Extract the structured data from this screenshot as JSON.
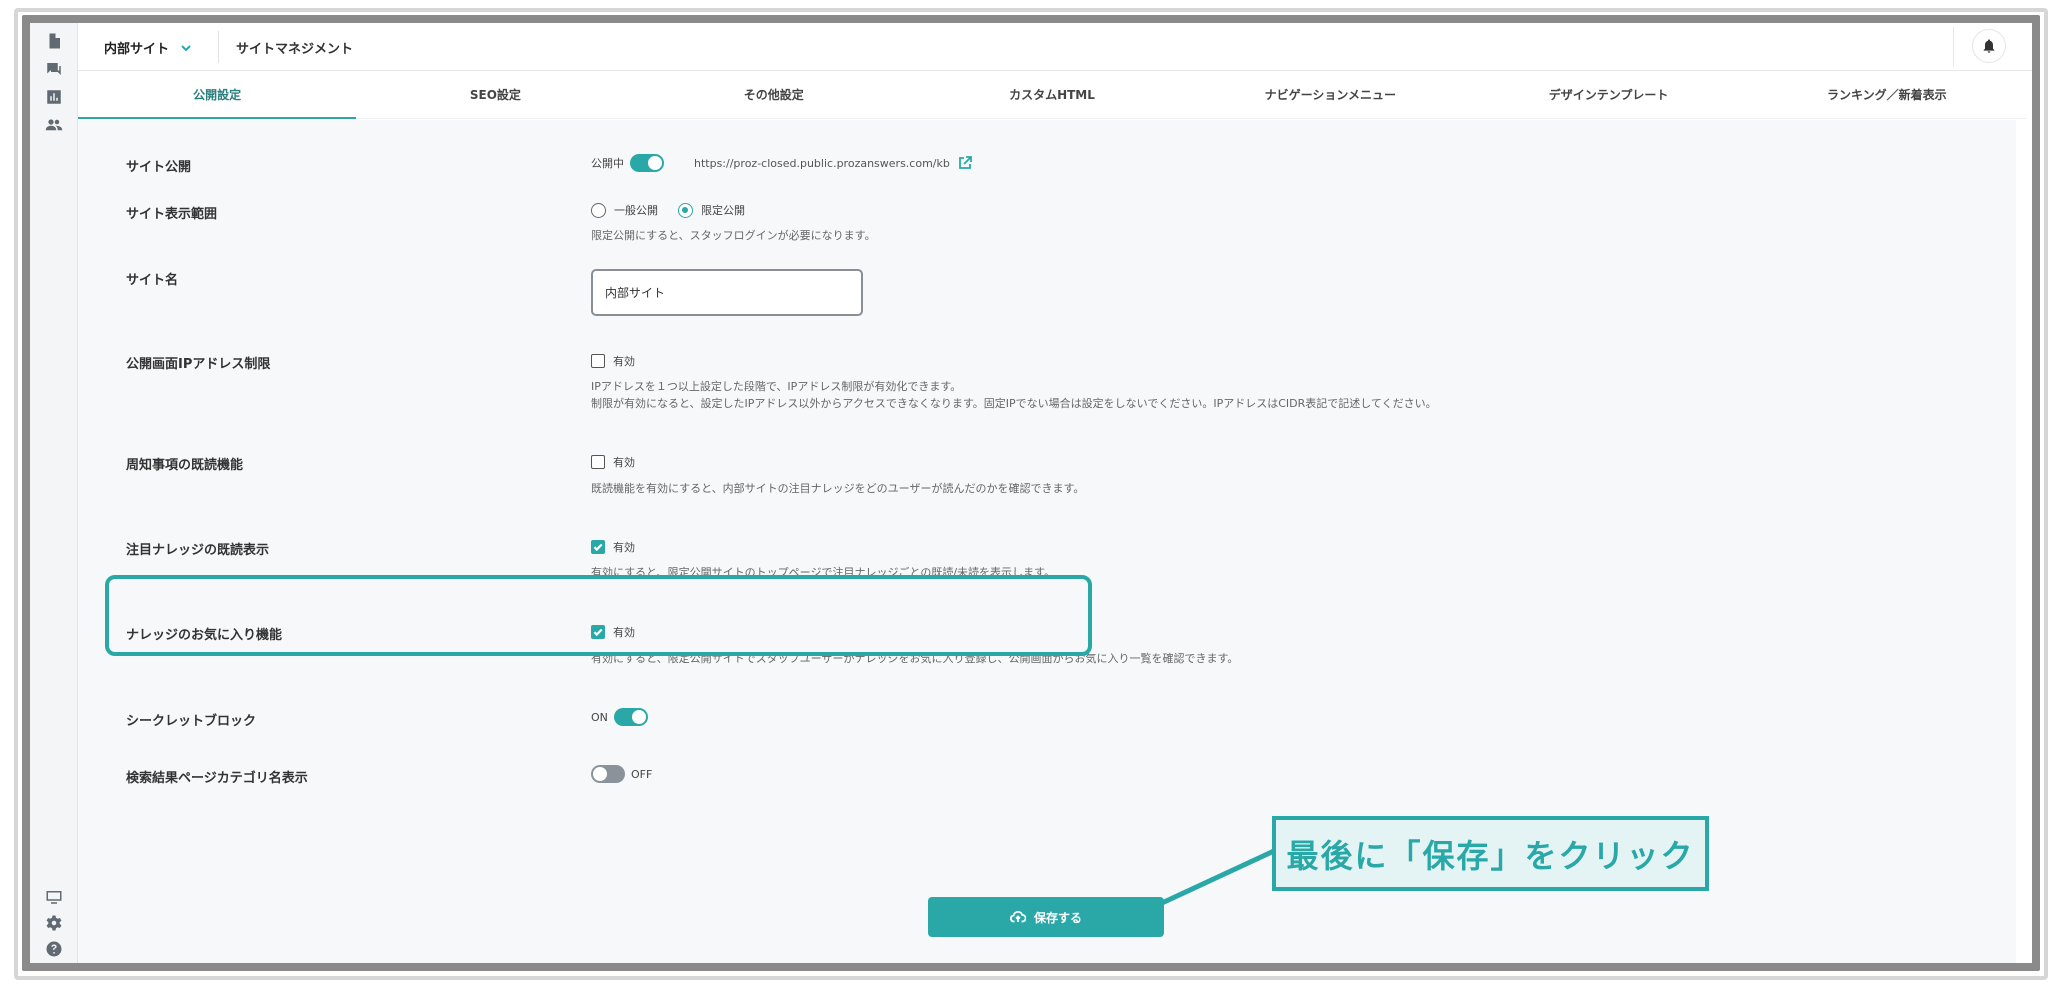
{
  "header": {
    "site_name": "内部サイト",
    "title": "サイトマネジメント"
  },
  "tabs": [
    {
      "label": "公開設定",
      "active": true
    },
    {
      "label": "SEO設定",
      "active": false
    },
    {
      "label": "その他設定",
      "active": false
    },
    {
      "label": "カスタムHTML",
      "active": false
    },
    {
      "label": "ナビゲーションメニュー",
      "active": false
    },
    {
      "label": "デザインテンプレート",
      "active": false
    },
    {
      "label": "ランキング／新着表示",
      "active": false
    }
  ],
  "settings": {
    "publish": {
      "label": "サイト公開",
      "status": "公開中",
      "toggle_on": true,
      "url": "https://proz-closed.public.prozanswers.com/kb"
    },
    "visibility": {
      "label": "サイト表示範囲",
      "option_public": "一般公開",
      "option_limited": "限定公開",
      "selected": "限定公開",
      "help": "限定公開にすると、スタッフログインが必要になります。"
    },
    "site_name": {
      "label": "サイト名",
      "value": "内部サイト"
    },
    "ip_restriction": {
      "label": "公開画面IPアドレス制限",
      "checkbox_label": "有効",
      "checked": false,
      "help_line1": "IPアドレスを１つ以上設定した段階で、IPアドレス制限が有効化できます。",
      "help_line2": "制限が有効になると、設定したIPアドレス以外からアクセスできなくなります。固定IPでない場合は設定をしないでください。IPアドレスはCIDR表記で記述してください。"
    },
    "notice_read": {
      "label": "周知事項の既読機能",
      "checkbox_label": "有効",
      "checked": false,
      "help": "既読機能を有効にすると、内部サイトの注目ナレッジをどのユーザーが読んだのかを確認できます。"
    },
    "featured_read": {
      "label": "注目ナレッジの既読表示",
      "checkbox_label": "有効",
      "checked": true,
      "help": "有効にすると、限定公開サイトのトップページで注目ナレッジごとの既読/未読を表示します。"
    },
    "favorites": {
      "label": "ナレッジのお気に入り機能",
      "checkbox_label": "有効",
      "checked": true,
      "help": "有効にすると、限定公開サイトでスタッフユーザーがナレッジをお気に入り登録し、公開画面からお気に入り一覧を確認できます。"
    },
    "secret_block": {
      "label": "シークレットブロック",
      "state_label": "ON",
      "toggle_on": true
    },
    "category_display": {
      "label": "検索結果ページカテゴリ名表示",
      "state_label": "OFF",
      "toggle_on": false
    }
  },
  "save_button": "保存する",
  "callout": "最後に「保存」をクリック",
  "colors": {
    "accent": "#2aa8a8",
    "callout_bg": "#e4f4f5"
  },
  "icons": {
    "rail": [
      "document-icon",
      "chat-icon",
      "chart-icon",
      "users-icon",
      "monitor-icon",
      "gear-icon",
      "help-icon"
    ]
  }
}
